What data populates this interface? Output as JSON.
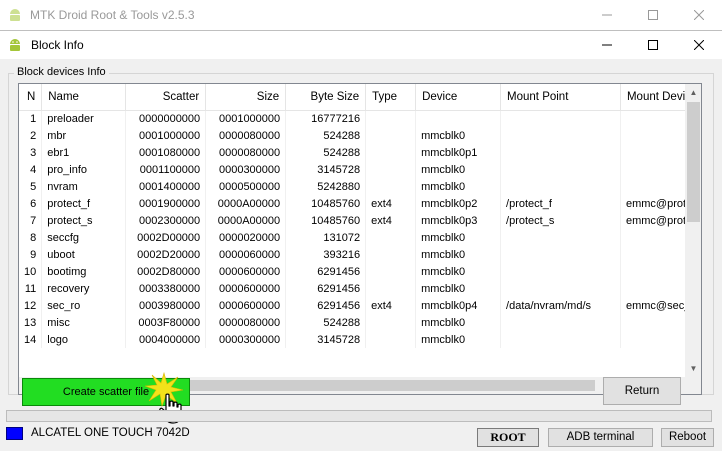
{
  "main_window": {
    "title": "MTK Droid Root & Tools v2.5.3"
  },
  "dialog": {
    "title": "Block Info",
    "group_label": "Block devices Info",
    "table": {
      "columns": [
        "N",
        "Name",
        "Scatter",
        "Size",
        "Byte Size",
        "Type",
        "Device",
        "Mount Point",
        "Mount Devic"
      ],
      "rows": [
        [
          "1",
          "preloader",
          "0000000000",
          "0001000000",
          "16777216",
          "",
          "",
          "",
          ""
        ],
        [
          "2",
          "mbr",
          "0001000000",
          "0000080000",
          "524288",
          "",
          "mmcblk0",
          "",
          ""
        ],
        [
          "3",
          "ebr1",
          "0001080000",
          "0000080000",
          "524288",
          "",
          "mmcblk0p1",
          "",
          ""
        ],
        [
          "4",
          "pro_info",
          "0001100000",
          "0000300000",
          "3145728",
          "",
          "mmcblk0",
          "",
          ""
        ],
        [
          "5",
          "nvram",
          "0001400000",
          "0000500000",
          "5242880",
          "",
          "mmcblk0",
          "",
          ""
        ],
        [
          "6",
          "protect_f",
          "0001900000",
          "0000A00000",
          "10485760",
          "ext4",
          "mmcblk0p2",
          "/protect_f",
          "emmc@prote"
        ],
        [
          "7",
          "protect_s",
          "0002300000",
          "0000A00000",
          "10485760",
          "ext4",
          "mmcblk0p3",
          "/protect_s",
          "emmc@prote"
        ],
        [
          "8",
          "seccfg",
          "0002D00000",
          "0000020000",
          "131072",
          "",
          "mmcblk0",
          "",
          ""
        ],
        [
          "9",
          "uboot",
          "0002D20000",
          "0000060000",
          "393216",
          "",
          "mmcblk0",
          "",
          ""
        ],
        [
          "10",
          "bootimg",
          "0002D80000",
          "0000600000",
          "6291456",
          "",
          "mmcblk0",
          "",
          ""
        ],
        [
          "11",
          "recovery",
          "0003380000",
          "0000600000",
          "6291456",
          "",
          "mmcblk0",
          "",
          ""
        ],
        [
          "12",
          "sec_ro",
          "0003980000",
          "0000600000",
          "6291456",
          "ext4",
          "mmcblk0p4",
          "/data/nvram/md/s",
          "emmc@sec_"
        ],
        [
          "13",
          "misc",
          "0003F80000",
          "0000080000",
          "524288",
          "",
          "mmcblk0",
          "",
          ""
        ],
        [
          "14",
          "logo",
          "0004000000",
          "0000300000",
          "3145728",
          "",
          "mmcblk0",
          "",
          ""
        ]
      ]
    },
    "create_scatter_label": "Create scatter file",
    "return_label": "Return"
  },
  "status_bar": {
    "device_name": "ALCATEL ONE TOUCH 7042D",
    "device_color": "#0000ff",
    "root_label": "ROOT",
    "adb_label": "ADB terminal",
    "reboot_label": "Reboot"
  },
  "icons": {
    "android": "android-icon",
    "minimize": "minimize-icon",
    "maximize": "maximize-icon",
    "close": "close-icon",
    "cursor": "hand-cursor-icon"
  },
  "colors": {
    "create_button": "#22dd22",
    "device_indicator": "#0000ff"
  }
}
